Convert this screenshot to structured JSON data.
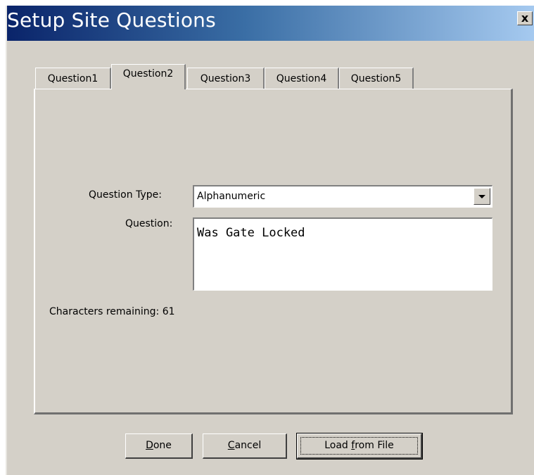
{
  "window": {
    "title": "Setup Site Questions",
    "close_label": "x"
  },
  "tabs": [
    {
      "label": "Question1",
      "active": false
    },
    {
      "label": "Question2",
      "active": true
    },
    {
      "label": "Question3",
      "active": false
    },
    {
      "label": "Question4",
      "active": false
    },
    {
      "label": "Question5",
      "active": false
    }
  ],
  "form": {
    "question_type_label": "Question Type:",
    "question_type_value": "Alphanumeric",
    "question_label": "Question:",
    "question_value": "Was Gate Locked",
    "chars_remaining_label": "Characters remaining:",
    "chars_remaining_value": "61"
  },
  "buttons": {
    "done": {
      "first": "D",
      "rest": "one"
    },
    "cancel": {
      "first": "C",
      "rest": "ancel"
    },
    "load": {
      "pre": "Load ",
      "accel": "f",
      "post": "rom File"
    }
  }
}
